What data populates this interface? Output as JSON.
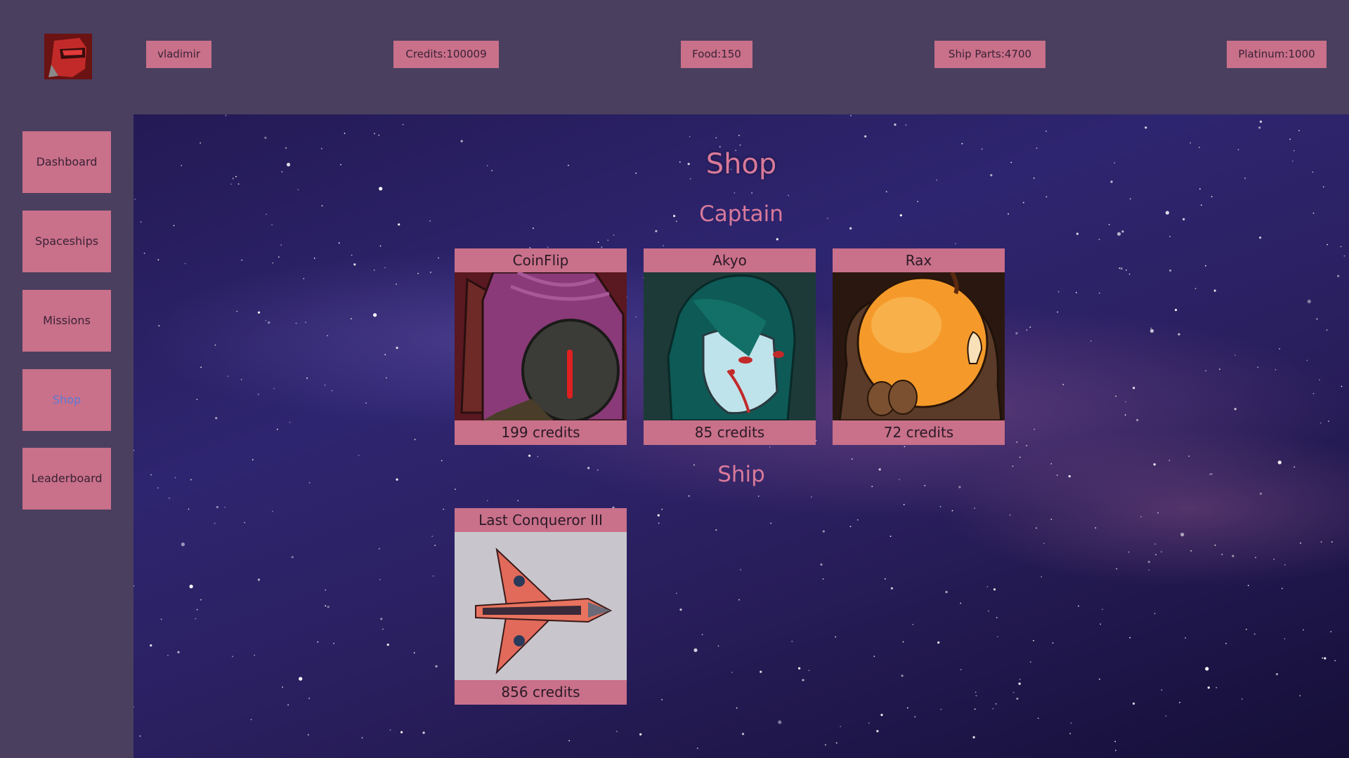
{
  "header": {
    "username": "vladimir",
    "credits": "Credits:100009",
    "food": "Food:150",
    "ship_parts": "Ship Parts:4700",
    "platinum": "Platinum:1000"
  },
  "sidebar": {
    "items": [
      {
        "label": "Dashboard"
      },
      {
        "label": "Spaceships"
      },
      {
        "label": "Missions"
      },
      {
        "label": "Shop",
        "active": true
      },
      {
        "label": "Leaderboard"
      }
    ]
  },
  "main": {
    "title": "Shop",
    "captain_heading": "Captain",
    "ship_heading": "Ship",
    "captains": [
      {
        "name": "CoinFlip",
        "price": "199 credits",
        "icon": "hooded-alien-portrait"
      },
      {
        "name": "Akyo",
        "price": "85 credits",
        "icon": "cyborg-woman-portrait"
      },
      {
        "name": "Rax",
        "price": "72 credits",
        "icon": "orange-helmet-portrait"
      }
    ],
    "ships": [
      {
        "name": "Last Conqueror III",
        "price": "856 credits",
        "icon": "red-spaceship-image"
      }
    ]
  },
  "colors": {
    "panel": "#4a3f5f",
    "button": "#c9708a",
    "heading": "#d97a9a",
    "active_link": "#5a7bd8"
  }
}
